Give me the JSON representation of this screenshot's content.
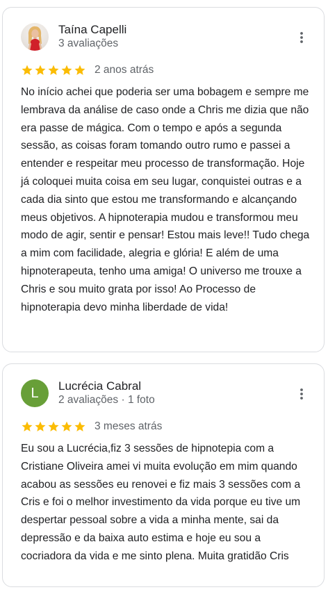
{
  "reviews": [
    {
      "name": "Taína Capelli",
      "meta": "3 avaliações",
      "rating": 5,
      "date": "2 anos atrás",
      "text": "No início achei que poderia ser uma bobagem e sempre me lembrava da análise de caso onde a Chris me dizia que não era passe de mágica. Com o tempo e após a segunda sessão, as coisas foram tomando outro rumo e passei a entender e respeitar meu processo de transformação. Hoje já coloquei muita coisa em seu lugar, conquistei outras e a cada dia sinto que estou me transformando e alcançando meus objetivos. A hipnoterapia mudou e transformou meu modo de agir, sentir e pensar! Estou mais leve!! Tudo chega a mim com facilidade, alegria e glória! E além de uma hipnoterapeuta, tenho uma amiga! O universo me trouxe a Chris e sou muito grata por isso! Ao Processo de hipnoterapia devo minha liberdade de vida!"
    },
    {
      "name": "Lucrécia Cabral",
      "avatar_letter": "L",
      "meta": "2 avaliações · 1 foto",
      "rating": 5,
      "date": "3 meses atrás",
      "text": "Eu sou a Lucrécia,fiz 3 sessões de hipnotepia com a Cristiane Oliveira amei vi muita evolução em mim quando acabou as sessões eu renovei e fiz mais 3 sessões com a Cris e foi o melhor investimento da vida porque eu tive um despertar pessoal sobre a vida a minha mente, sai da depressão e da baixa auto estima e hoje eu sou a cocriadora da vida e me sinto plena. Muita gratidão Cris"
    }
  ],
  "icons": {
    "star": "star-icon",
    "more": "more-vertical-icon"
  },
  "colors": {
    "star": "#fbbc04",
    "avatar_letter_bg": "#689f38",
    "secondary_text": "#5f6368"
  }
}
